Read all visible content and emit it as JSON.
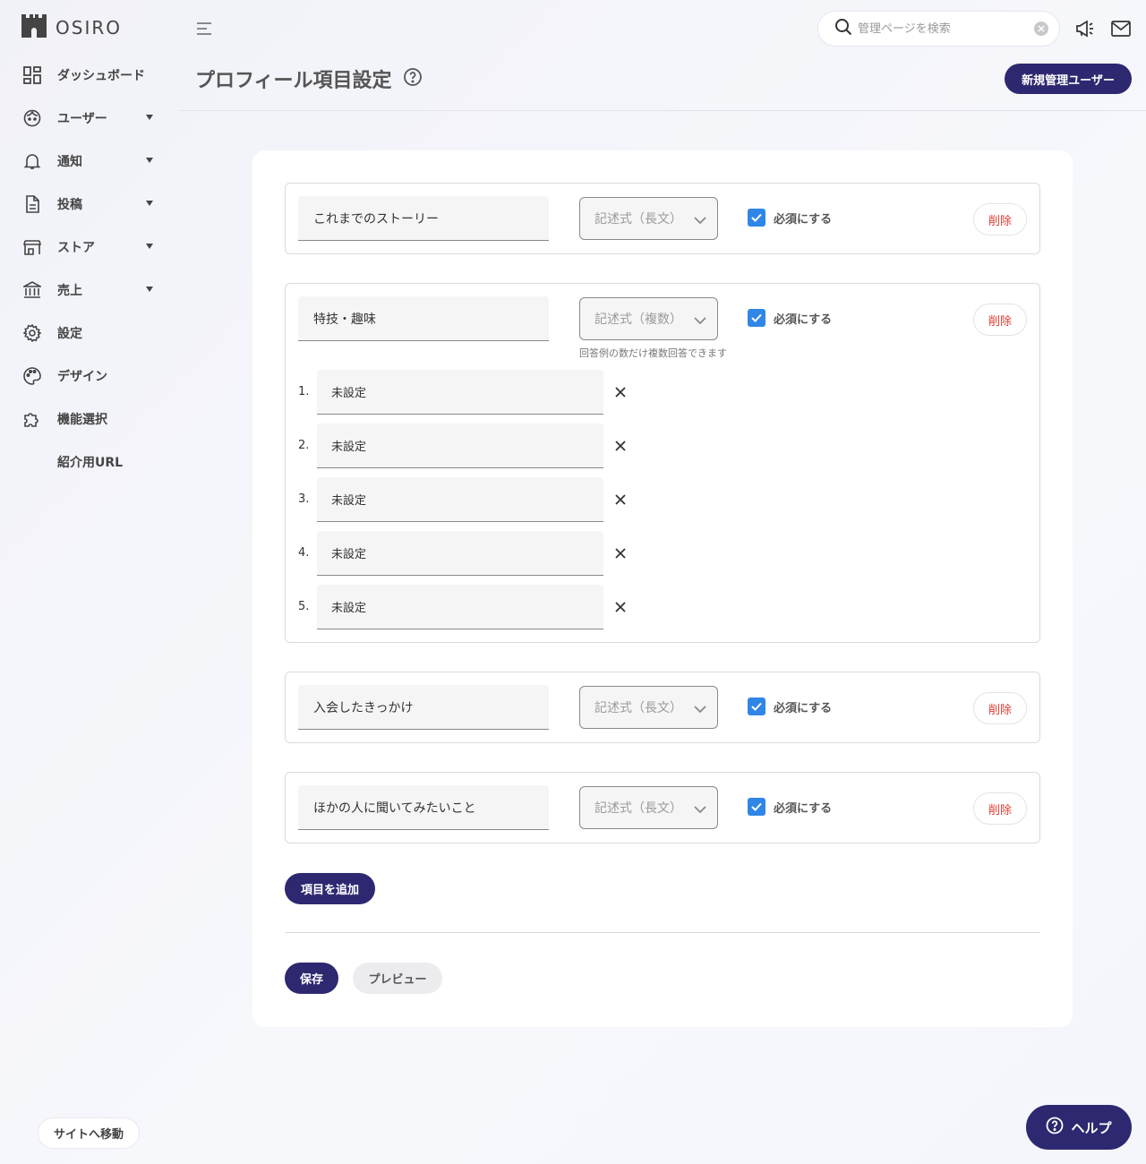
{
  "app": {
    "brand": "OSIRO"
  },
  "sidebar": {
    "items": [
      {
        "label": "ダッシュボード",
        "icon": "dashboard-icon",
        "has_caret": false
      },
      {
        "label": "ユーザー",
        "icon": "user-face-icon",
        "has_caret": true
      },
      {
        "label": "通知",
        "icon": "bell-icon",
        "has_caret": true
      },
      {
        "label": "投稿",
        "icon": "document-icon",
        "has_caret": true
      },
      {
        "label": "ストア",
        "icon": "store-icon",
        "has_caret": true
      },
      {
        "label": "売上",
        "icon": "bank-icon",
        "has_caret": true
      },
      {
        "label": "設定",
        "icon": "gear-icon",
        "has_caret": false
      },
      {
        "label": "デザイン",
        "icon": "palette-icon",
        "has_caret": false
      },
      {
        "label": "機能選択",
        "icon": "puzzle-icon",
        "has_caret": false
      },
      {
        "label": "紹介用URL",
        "icon": "",
        "has_caret": false
      }
    ],
    "site_button": "サイトへ移動"
  },
  "header": {
    "search_placeholder": "管理ページを検索",
    "page_title": "プロフィール項目設定",
    "new_admin_button": "新規管理ユーザー"
  },
  "form": {
    "required_label": "必須にする",
    "delete_label": "削除",
    "items": [
      {
        "name": "これまでのストーリー",
        "type": "記述式（長文）",
        "required": true
      },
      {
        "name": "特技・趣味",
        "type": "記述式（複数）",
        "required": true,
        "hint": "回答例の数だけ複数回答できます",
        "options": [
          {
            "num": "1.",
            "value": "未設定"
          },
          {
            "num": "2.",
            "value": "未設定"
          },
          {
            "num": "3.",
            "value": "未設定"
          },
          {
            "num": "4.",
            "value": "未設定"
          },
          {
            "num": "5.",
            "value": "未設定"
          }
        ]
      },
      {
        "name": "入会したきっかけ",
        "type": "記述式（長文）",
        "required": true
      },
      {
        "name": "ほかの人に聞いてみたいこと",
        "type": "記述式（長文）",
        "required": true
      }
    ],
    "add_button": "項目を追加",
    "save_button": "保存",
    "preview_button": "プレビュー"
  },
  "help_button": "ヘルプ",
  "colors": {
    "primary": "#2d2870",
    "checkbox": "#2f86e6",
    "delete": "#e23a30"
  }
}
